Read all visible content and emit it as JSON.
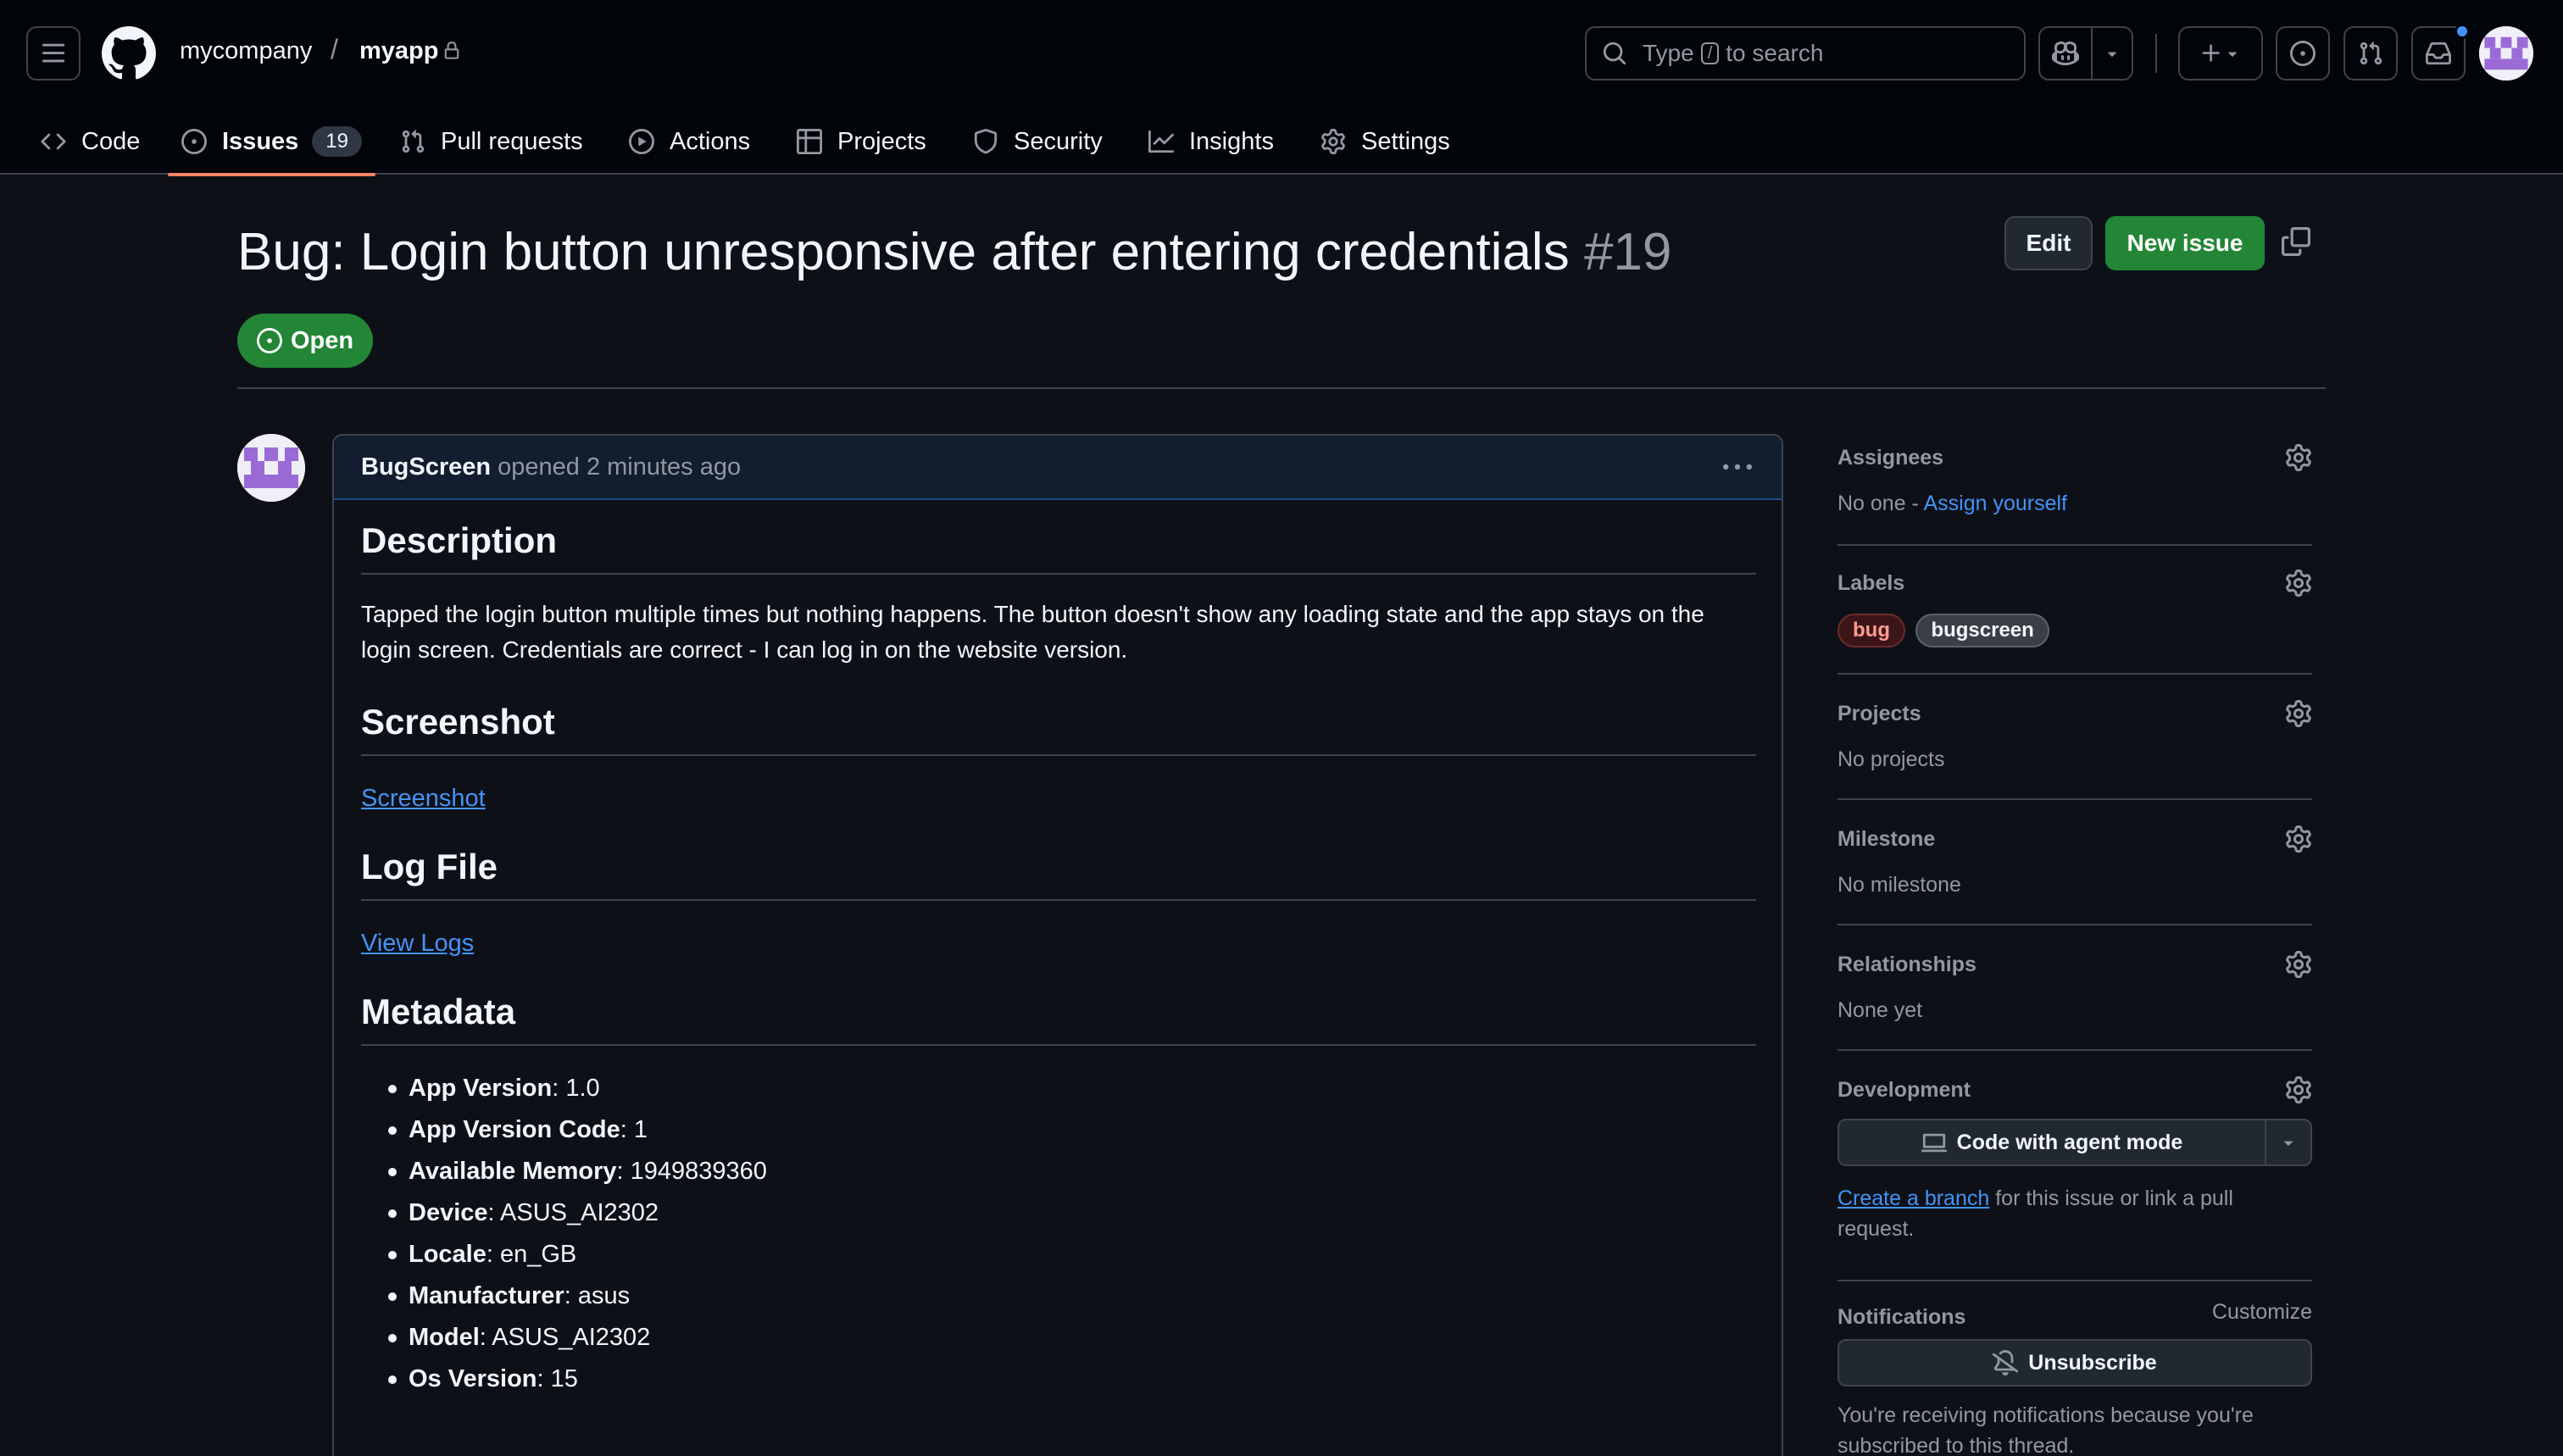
{
  "header": {
    "owner": "mycompany",
    "separator": "/",
    "repo": "myapp",
    "search_prefix": "Type",
    "search_key": "/",
    "search_suffix": "to search"
  },
  "tabs": [
    {
      "label": "Code",
      "icon": "code-icon"
    },
    {
      "label": "Issues",
      "icon": "issue-opened-icon",
      "count": "19",
      "active": true
    },
    {
      "label": "Pull requests",
      "icon": "git-pull-request-icon"
    },
    {
      "label": "Actions",
      "icon": "play-icon"
    },
    {
      "label": "Projects",
      "icon": "table-icon"
    },
    {
      "label": "Security",
      "icon": "shield-icon"
    },
    {
      "label": "Insights",
      "icon": "graph-icon"
    },
    {
      "label": "Settings",
      "icon": "gear-icon"
    }
  ],
  "issue": {
    "title": "Bug: Login button unresponsive after entering credentials",
    "number": "#19",
    "state": "Open",
    "edit_label": "Edit",
    "new_issue_label": "New issue"
  },
  "comment": {
    "author": "BugScreen",
    "action": "opened",
    "time": "2 minutes ago",
    "sections": {
      "description_heading": "Description",
      "description_text": "Tapped the login button multiple times but nothing happens. The button doesn't show any loading state and the app stays on the login screen. Credentials are correct - I can log in on the website version.",
      "screenshot_heading": "Screenshot",
      "screenshot_link": "Screenshot",
      "log_heading": "Log File",
      "log_link": "View Logs",
      "metadata_heading": "Metadata"
    },
    "metadata": [
      {
        "key": "App Version",
        "value": ": 1.0"
      },
      {
        "key": "App Version Code",
        "value": ": 1"
      },
      {
        "key": "Available Memory",
        "value": ": 1949839360"
      },
      {
        "key": "Device",
        "value": ": ASUS_AI2302"
      },
      {
        "key": "Locale",
        "value": ": en_GB"
      },
      {
        "key": "Manufacturer",
        "value": ": asus"
      },
      {
        "key": "Model",
        "value": ": ASUS_AI2302"
      },
      {
        "key": "Os Version",
        "value": ": 15"
      }
    ]
  },
  "sidebar": {
    "assignees": {
      "heading": "Assignees",
      "value": "No one -",
      "link": "Assign yourself"
    },
    "labels": {
      "heading": "Labels",
      "items": [
        "bug",
        "bugscreen"
      ]
    },
    "projects": {
      "heading": "Projects",
      "value": "No projects"
    },
    "milestone": {
      "heading": "Milestone",
      "value": "No milestone"
    },
    "relationships": {
      "heading": "Relationships",
      "value": "None yet"
    },
    "development": {
      "heading": "Development",
      "button": "Code with agent mode",
      "link": "Create a branch",
      "text": " for this issue or link a pull request."
    },
    "notifications": {
      "heading": "Notifications",
      "customize": "Customize",
      "button": "Unsubscribe",
      "text": "You're receiving notifications because you're subscribed to this thread."
    }
  },
  "colors": {
    "background": "#0d1117",
    "header": "#010409",
    "accent_green": "#238636",
    "link": "#4493f8",
    "label_bug": "#f85149",
    "tab_underline": "#f78166"
  }
}
